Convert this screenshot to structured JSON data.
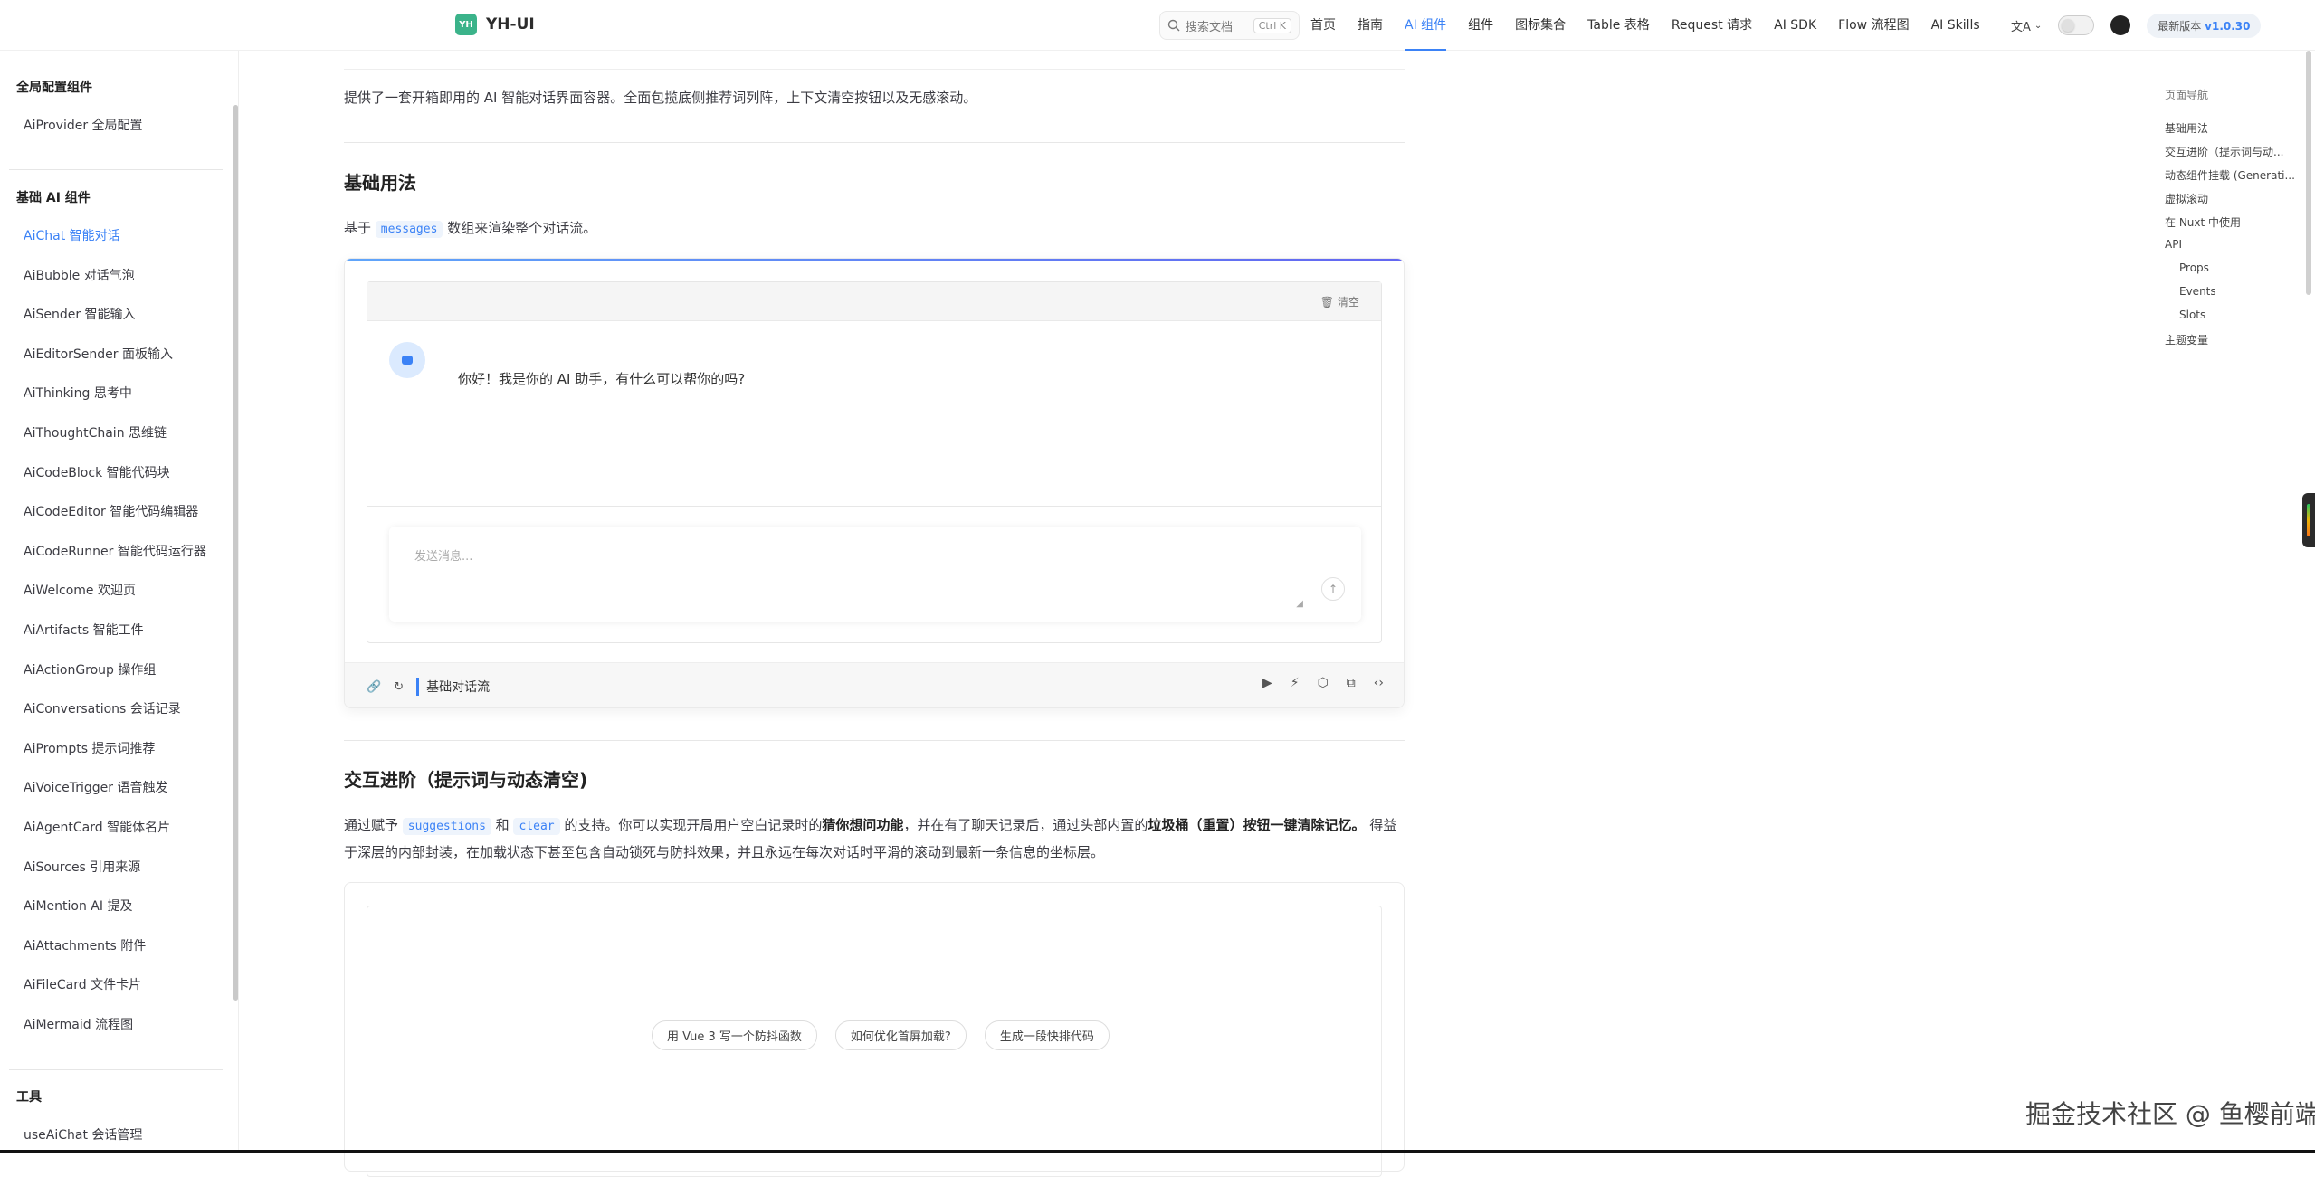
{
  "nav": {
    "logo_badge": "YH",
    "logo_text": "YH-UI",
    "search_placeholder": "搜索文档",
    "search_kbd": "Ctrl K",
    "links": [
      "首页",
      "指南",
      "AI 组件",
      "组件",
      "图标集合",
      "Table 表格",
      "Request 请求",
      "AI SDK",
      "Flow 流程图",
      "AI Skills"
    ],
    "active_link": "AI 组件",
    "lang_icon": "文A",
    "version_label": "最新版本",
    "version": "v1.0.30"
  },
  "sidebar": {
    "section1": "全局配置组件",
    "section1_items": [
      "AiProvider 全局配置"
    ],
    "section2": "基础 AI 组件",
    "section2_items": [
      "AiChat 智能对话",
      "AiBubble 对话气泡",
      "AiSender 智能输入",
      "AiEditorSender 面板输入",
      "AiThinking 思考中",
      "AiThoughtChain 思维链",
      "AiCodeBlock 智能代码块",
      "AiCodeEditor 智能代码编辑器",
      "AiCodeRunner 智能代码运行器",
      "AiWelcome 欢迎页",
      "AiArtifacts 智能工件",
      "AiActionGroup 操作组",
      "AiConversations 会话记录",
      "AiPrompts 提示词推荐",
      "AiVoiceTrigger 语音触发",
      "AiAgentCard 智能体名片",
      "AiSources 引用来源",
      "AiMention AI 提及",
      "AiAttachments 附件",
      "AiFileCard 文件卡片",
      "AiMermaid 流程图"
    ],
    "active_item": "AiChat 智能对话",
    "section3": "工具",
    "section3_items": [
      "useAiChat 会话管理"
    ]
  },
  "main": {
    "intro": "提供了一套开箱即用的 AI 智能对话界面容器。全面包揽底侧推荐词列阵，上下文清空按钮以及无感滚动。",
    "h2_basic": "基础用法",
    "basic_pre": "基于",
    "basic_code": "messages",
    "basic_post": "数组来渲染整个对话流。",
    "demo1": {
      "clear_label": "清空",
      "assistant_msg": "你好！我是你的 AI 助手，有什么可以帮你的吗?",
      "input_placeholder": "发送消息...",
      "footer_title": "基础对话流"
    },
    "h2_advanced": "交互进阶（提示词与动态清空)",
    "adv_p1": "通过赋予",
    "adv_code1": "suggestions",
    "adv_p2": "和",
    "adv_code2": "clear",
    "adv_p3": "的支持。你可以实现开局用户空白记录时的",
    "adv_b1": "猜你想问功能",
    "adv_p4": "，并在有了聊天记录后，通过头部内置的",
    "adv_b2": "垃圾桶（重置）按钮一键清除记",
    "adv_b3": "忆。",
    "adv_p5": " 得益于深层的内部封装，在加载状态下甚至包含自动锁死与防抖效果，并且永远在每次对话时平滑的滚动到最新一条信息的坐标层。",
    "demo2_chips": [
      "用 Vue 3 写一个防抖函数",
      "如何优化首屏加载?",
      "生成一段快排代码"
    ]
  },
  "toc": {
    "title": "页面导航",
    "items": [
      {
        "label": "基础用法",
        "sub": false
      },
      {
        "label": "交互进阶（提示词与动...",
        "sub": false
      },
      {
        "label": "动态组件挂载 (Generati...",
        "sub": false
      },
      {
        "label": "虚拟滚动",
        "sub": false
      },
      {
        "label": "在 Nuxt 中使用",
        "sub": false
      },
      {
        "label": "API",
        "sub": false
      },
      {
        "label": "Props",
        "sub": true
      },
      {
        "label": "Events",
        "sub": true
      },
      {
        "label": "Slots",
        "sub": true
      },
      {
        "label": "主题变量",
        "sub": false
      }
    ]
  },
  "watermark": "掘金技术社区 @ 鱼樱前端",
  "colors": {
    "accent": "#3b82f6",
    "logo": "#3bb38a"
  }
}
